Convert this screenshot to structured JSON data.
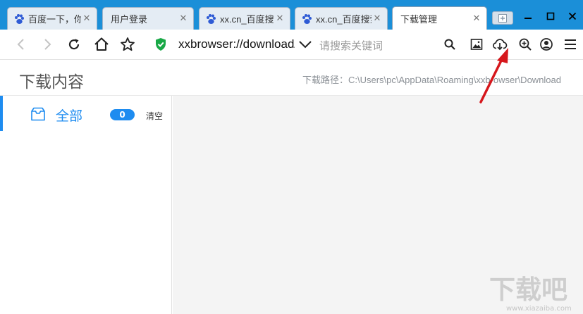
{
  "tabs": [
    {
      "title": "百度一下，你",
      "favicon": "baidu-paw-icon",
      "active": false
    },
    {
      "title": "用户登录",
      "favicon": "",
      "active": false
    },
    {
      "title": "xx.cn_百度搜索",
      "favicon": "baidu-paw-icon",
      "active": false
    },
    {
      "title": "xx.cn_百度搜索",
      "favicon": "baidu-paw-icon",
      "active": false
    },
    {
      "title": "下载管理",
      "favicon": "",
      "active": true
    }
  ],
  "address_bar": {
    "url": "xxbrowser://download/",
    "search_placeholder": "请搜索关键词"
  },
  "header": {
    "title": "下载内容",
    "download_path": "下载路径：C:\\Users\\pc\\AppData\\Roaming\\xxbrowser\\Download"
  },
  "sidebar": {
    "items": [
      {
        "label": "全部",
        "count": "0",
        "clear_label": "清空",
        "icon": "inbox-tray-icon"
      }
    ]
  },
  "watermark": {
    "text": "下载吧",
    "url": "www.xiazaiba.com"
  },
  "colors": {
    "tabstrip": "#1b8fd8",
    "accent": "#1e8cf0",
    "annotation": "#d6171c",
    "secure": "#18a846"
  }
}
